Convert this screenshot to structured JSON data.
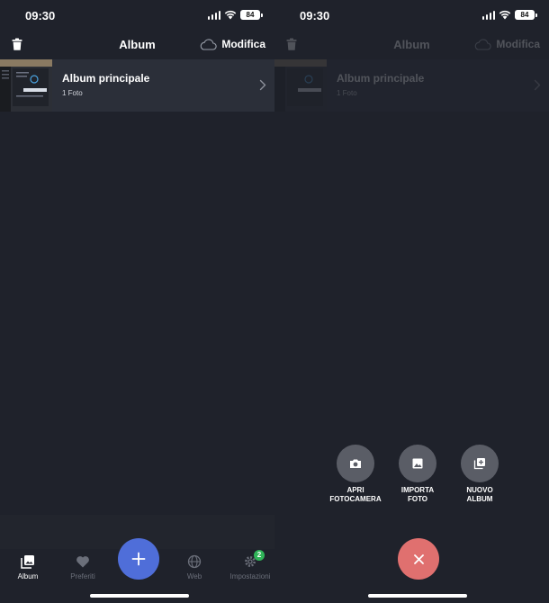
{
  "status": {
    "time": "09:30",
    "battery": "84"
  },
  "nav": {
    "title": "Album",
    "edit_label": "Modifica"
  },
  "album": {
    "name": "Album principale",
    "count": "1 Foto"
  },
  "tabs": [
    {
      "label": "Album",
      "icon": "photos-icon",
      "active": true
    },
    {
      "label": "Preferiti",
      "icon": "heart-icon",
      "active": false
    },
    {
      "label": "Web",
      "icon": "globe-icon",
      "active": false
    },
    {
      "label": "Impostazioni",
      "icon": "gear-icon",
      "active": false,
      "badge": "2"
    }
  ],
  "actions": [
    {
      "label": "APRI FOTOCAMERA",
      "icon": "camera-icon"
    },
    {
      "label": "IMPORTA FOTO",
      "icon": "image-icon"
    },
    {
      "label": "NUOVO ALBUM",
      "icon": "add-album-icon"
    }
  ],
  "colors": {
    "background": "#1f222b",
    "row": "#2b2f39",
    "fab_add": "#4f6ed9",
    "fab_close": "#e0706f",
    "badge": "#2fb458",
    "action_button": "#5a5d66"
  }
}
